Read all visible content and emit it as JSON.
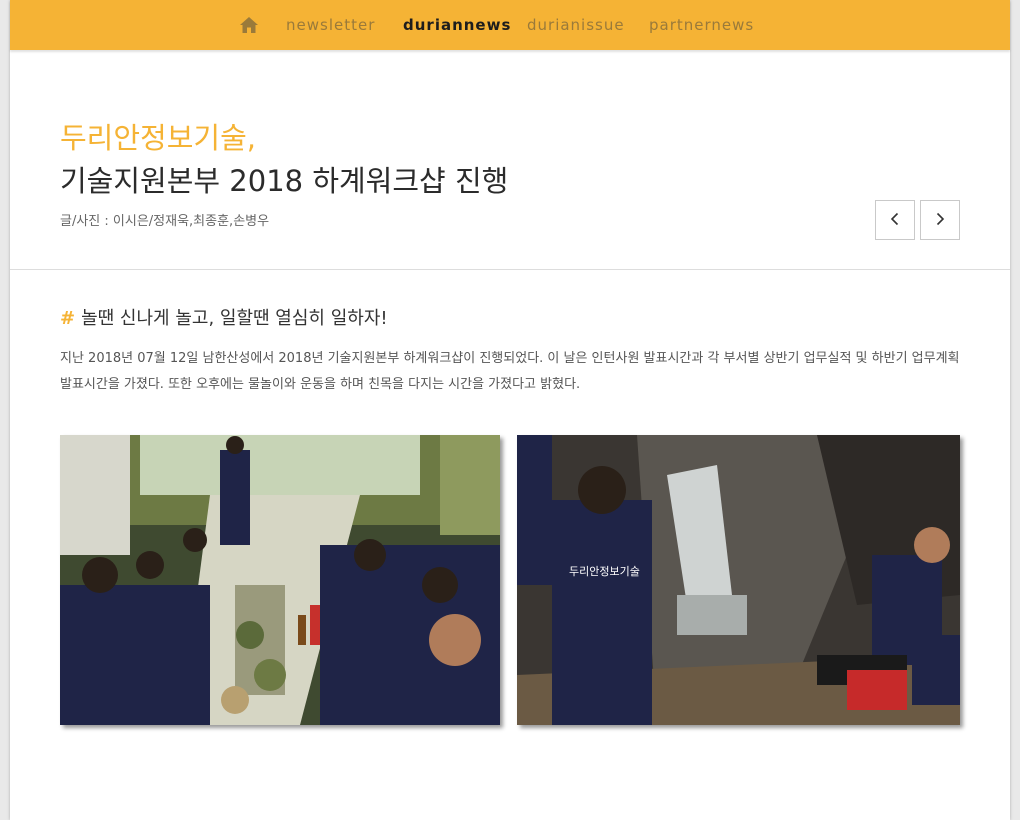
{
  "nav": {
    "home_icon": "home-icon",
    "items": [
      {
        "label": "newsletter",
        "active": false
      },
      {
        "label": "duriannews",
        "active": true
      },
      {
        "label": "durianissue",
        "active": false
      },
      {
        "label": "partnernews",
        "active": false
      }
    ]
  },
  "article": {
    "headline_line1": "두리안정보기술,",
    "headline_line2": "기술지원본부 2018 하계워크샵 진행",
    "byline": "글/사진 : 이시은/정재욱,최종훈,손병우",
    "prev_icon": "chevron-left-icon",
    "next_icon": "chevron-right-icon",
    "section_hash": "#",
    "section_title": "놀땐 신나게 놀고, 일할땐 열심히 일하자!",
    "body": "지난 2018년 07월 12일 남한산성에서 2018년 기술지원본부 하계워크샵이 진행되었다. 이 날은 인턴사원 발표시간과 각 부서별 상반기 업무실적 및 하반기 업무계획 발표시간을 가졌다. 또한 오후에는 물놀이와 운동을 하며 친목을 다지는 시간을 가졌다고 밝혔다.",
    "photo_shirt_text": "두리안정보기술"
  },
  "colors": {
    "accent": "#f5b335",
    "text_dark": "#2b2b2b",
    "nav_inactive": "#9a7a3a"
  }
}
